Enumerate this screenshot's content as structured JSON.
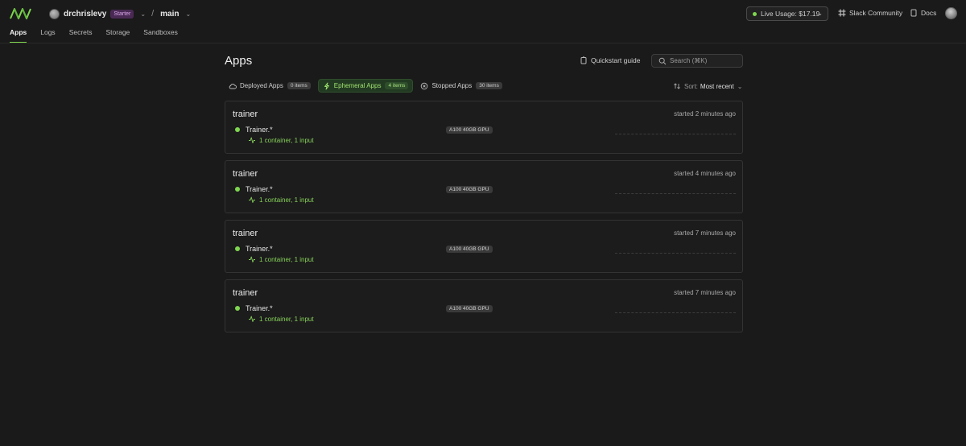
{
  "header": {
    "workspace": {
      "name": "drchrislevy",
      "plan": "Starter"
    },
    "environment": "main",
    "live_usage": "Live Usage: $17.19",
    "slack": "Slack Community",
    "docs": "Docs",
    "colors": {
      "accent": "#7fd64f",
      "plan_badge_bg": "#4a2a55"
    }
  },
  "nav": {
    "items": [
      {
        "label": "Apps",
        "active": true
      },
      {
        "label": "Logs"
      },
      {
        "label": "Secrets"
      },
      {
        "label": "Storage"
      },
      {
        "label": "Sandboxes"
      }
    ]
  },
  "page": {
    "title": "Apps",
    "quickstart": "Quickstart guide",
    "search_placeholder": "Search (⌘K)"
  },
  "tabs": [
    {
      "label": "Deployed Apps",
      "count": "0 items",
      "icon": "cloud-icon"
    },
    {
      "label": "Ephemeral Apps",
      "count": "4 items",
      "icon": "lightning-icon",
      "active": true
    },
    {
      "label": "Stopped Apps",
      "count": "30 items",
      "icon": "stop-circle-icon"
    }
  ],
  "sort": {
    "label": "Sort:",
    "value": "Most recent"
  },
  "apps": [
    {
      "name": "trainer",
      "started": "started 2 minutes ago",
      "function": "Trainer.*",
      "status": "1 container, 1 input",
      "gpu": "A100 40GB GPU"
    },
    {
      "name": "trainer",
      "started": "started 4 minutes ago",
      "function": "Trainer.*",
      "status": "1 container, 1 input",
      "gpu": "A100 40GB GPU"
    },
    {
      "name": "trainer",
      "started": "started 7 minutes ago",
      "function": "Trainer.*",
      "status": "1 container, 1 input",
      "gpu": "A100 40GB GPU"
    },
    {
      "name": "trainer",
      "started": "started 7 minutes ago",
      "function": "Trainer.*",
      "status": "1 container, 1 input",
      "gpu": "A100 40GB GPU"
    }
  ]
}
